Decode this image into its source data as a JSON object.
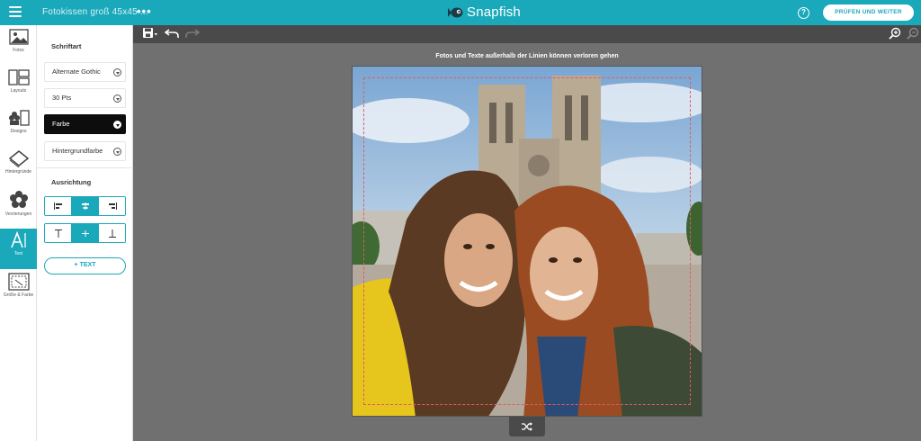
{
  "header": {
    "document_title": "Fotokissen groß 45x45 ...",
    "more_label": "•••",
    "brand": "Snapfish",
    "help_label": "?",
    "review_button": "PRÜFEN UND WEITER"
  },
  "rail": {
    "items": [
      {
        "label": "Fotos",
        "icon": "photos-icon"
      },
      {
        "label": "Layouts",
        "icon": "layouts-icon"
      },
      {
        "label": "Designs",
        "icon": "designs-icon"
      },
      {
        "label": "Hintergründe",
        "icon": "backgrounds-icon"
      },
      {
        "label": "Verzierungen",
        "icon": "embellishments-icon"
      },
      {
        "label": "Text",
        "icon": "text-icon",
        "active": true
      },
      {
        "label": "Größe & Farbe",
        "icon": "size-color-icon"
      }
    ]
  },
  "panel": {
    "font_heading": "Schriftart",
    "font_family": "Alternate Gothic",
    "font_size": "30 Pts",
    "color_label": "Farbe",
    "bg_color_label": "Hintergrundfarbe",
    "alignment_heading": "Ausrichtung",
    "horizontal_align": {
      "options": [
        "left",
        "center",
        "right"
      ],
      "selected": "center"
    },
    "vertical_align": {
      "options": [
        "top",
        "middle",
        "bottom"
      ],
      "selected": "middle"
    },
    "add_text_button": "+ TEXT"
  },
  "canvas": {
    "warning": "Fotos und Texte außerhalb der Linien können verloren gehen"
  },
  "colors": {
    "accent": "#1aa9bb",
    "canvas_bg": "#707070",
    "toolbar": "#4a4a4a",
    "safe_line": "#e05a6a"
  }
}
